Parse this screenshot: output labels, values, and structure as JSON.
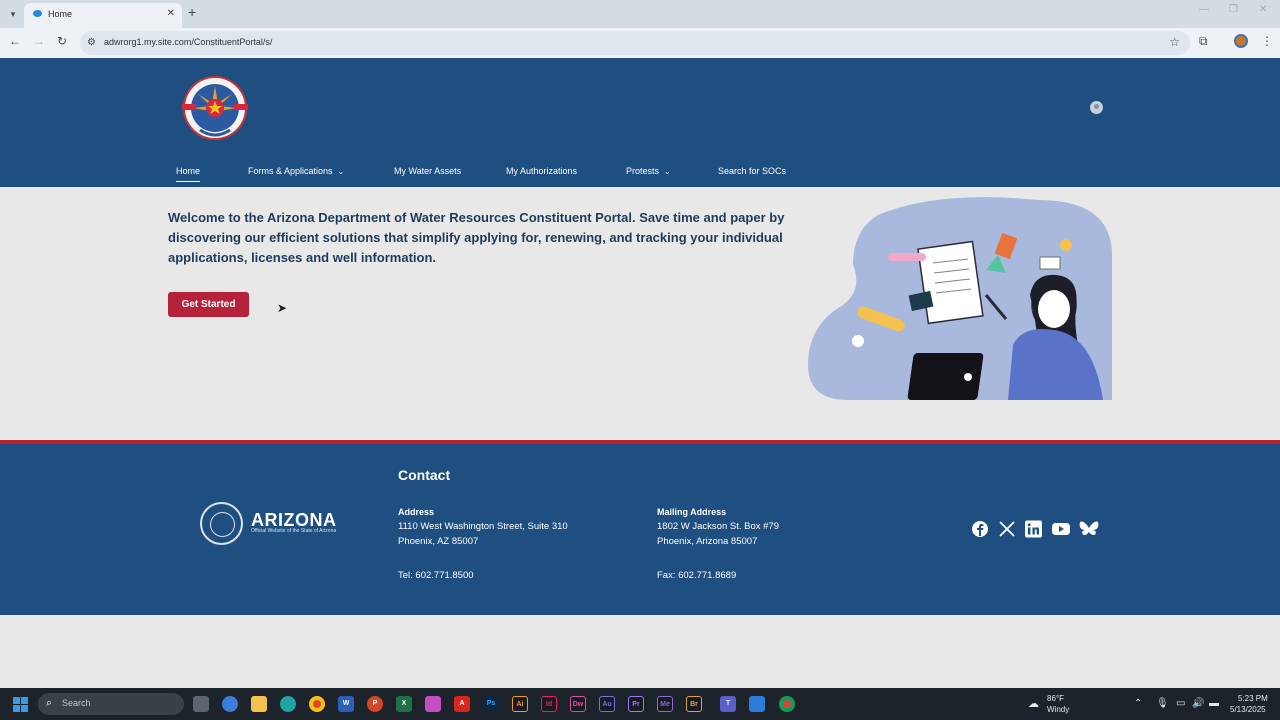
{
  "browser": {
    "tab_title": "Home",
    "url": "adwrorg1.my.site.com/ConstituentPortal/s/"
  },
  "nav": {
    "home": "Home",
    "forms": "Forms & Applications",
    "water_assets": "My Water Assets",
    "authorizations": "My Authorizations",
    "protests": "Protests",
    "socs": "Search for SOCs"
  },
  "hero": {
    "welcome": "Welcome to the Arizona Department of Water Resources Constituent Portal. Save time and paper by discovering our efficient solutions that simplify applying for, renewing, and tracking your individual applications, licenses and well information.",
    "cta": "Get Started"
  },
  "footer": {
    "brand": "ARIZONA",
    "brand_sub": "Official Website of the State of Arizona",
    "contact_heading": "Contact",
    "address_label": "Address",
    "address_line1": "1110 West Washington Street, Suite 310",
    "address_line2": "Phoenix, AZ 85007",
    "tel": "Tel: 602.771.8500",
    "mailing_label": "Mailing Address",
    "mailing_line1": "1802 W Jackson St. Box #79",
    "mailing_line2": "Phoenix, Arizona 85007",
    "fax": "Fax: 602.771.8689"
  },
  "taskbar": {
    "search_placeholder": "Search",
    "weather_temp": "86°F",
    "weather_desc": "Windy",
    "time": "5:23 PM",
    "date": "5/13/2025",
    "apps": [
      {
        "label": "Ai",
        "color": "#f29b1d"
      },
      {
        "label": "Id",
        "color": "#e0245e"
      },
      {
        "label": "Dw",
        "color": "#d94fa8"
      },
      {
        "label": "Au",
        "color": "#7b72d9"
      },
      {
        "label": "Pr",
        "color": "#9a7cf0"
      },
      {
        "label": "Me",
        "color": "#8a6bd8"
      },
      {
        "label": "Br",
        "color": "#d9a34a"
      }
    ]
  },
  "colors": {
    "brand_blue": "#1f4e80",
    "accent_red": "#b5223a"
  }
}
